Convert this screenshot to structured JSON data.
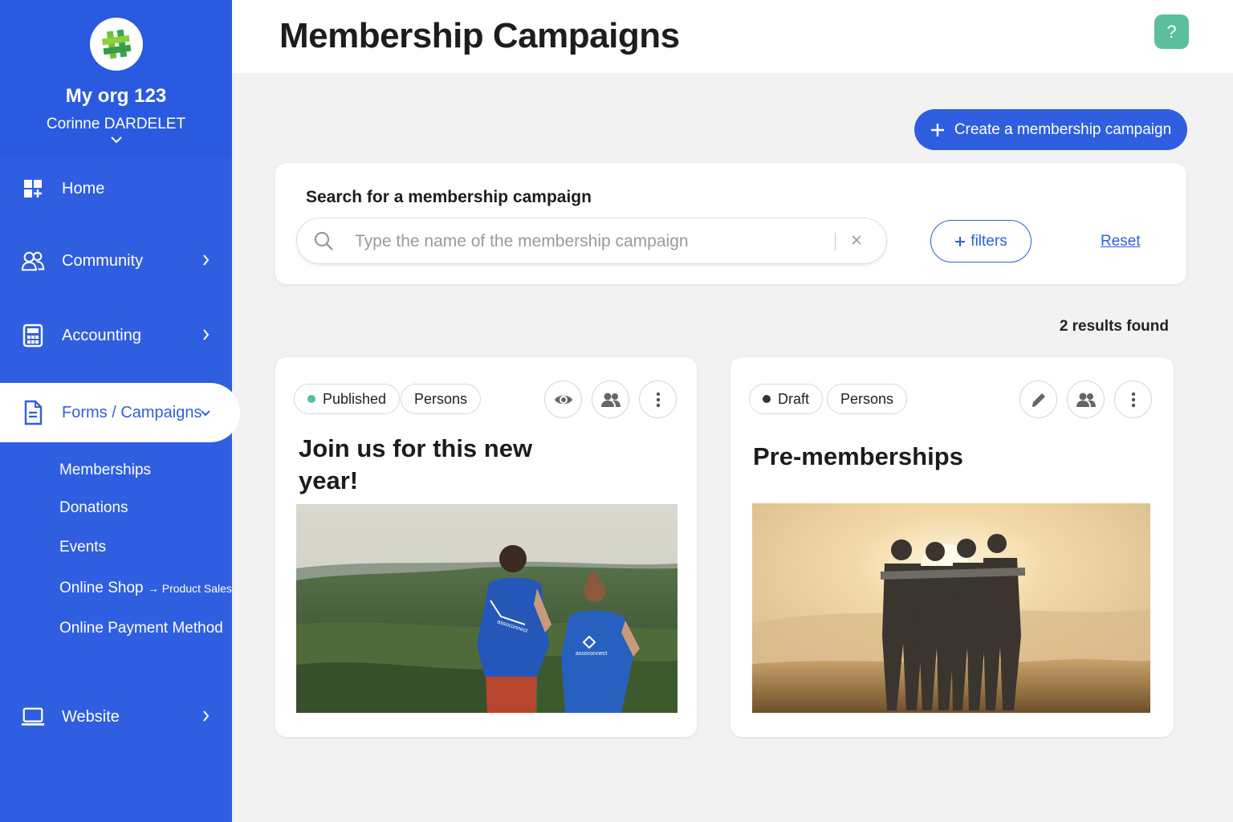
{
  "sidebar": {
    "org_name": "My org 123",
    "user_name": "Corinne DARDELET",
    "nav": {
      "home": "Home",
      "community": "Community",
      "accounting": "Accounting",
      "forms": "Forms / Campaigns",
      "website": "Website"
    },
    "sub_items": {
      "memberships": "Memberships",
      "donations": "Donations",
      "events": "Events",
      "online_shop": "Online Shop",
      "online_shop_arrow": "→ Product Sales",
      "payment": "Online Payment Method"
    }
  },
  "header": {
    "title": "Membership Campaigns",
    "help": "?"
  },
  "actions": {
    "create_label": "Create a membership campaign"
  },
  "search": {
    "title": "Search for a membership campaign",
    "placeholder": "Type the name of the membership campaign",
    "filters_label": "filters",
    "reset_label": "Reset"
  },
  "results_text": "2 results found",
  "campaigns": [
    {
      "status": "Published",
      "status_color": "#4cc39a",
      "audience": "Persons",
      "title_line1": "Join us for this new",
      "title_line2": "year!",
      "shirt_text": "assoconnect"
    },
    {
      "status": "Draft",
      "status_color": "#333333",
      "audience": "Persons",
      "title_line1": "Pre-memberships"
    }
  ],
  "colors": {
    "primary": "#2f5fe0",
    "help": "#5bbf9e"
  }
}
